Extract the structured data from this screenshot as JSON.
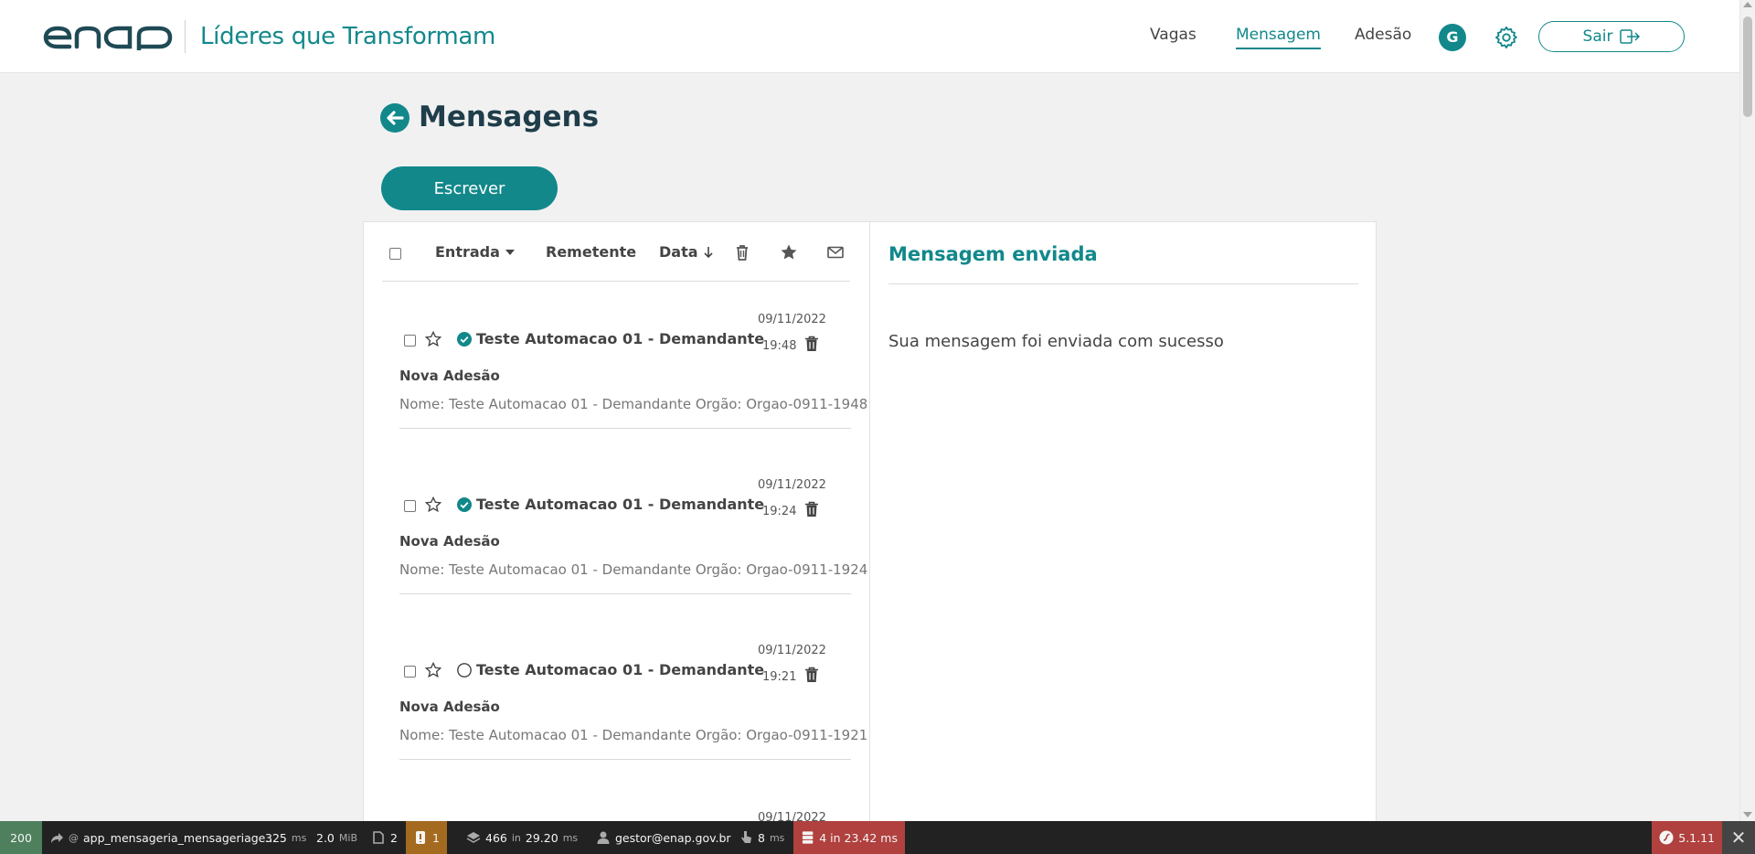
{
  "header": {
    "logo_text": "enap",
    "brand_title": "Líderes que Transformam",
    "nav": [
      {
        "label": "Vagas",
        "active": false
      },
      {
        "label": "Mensagem",
        "active": true
      },
      {
        "label": "Adesão",
        "active": false
      }
    ],
    "avatar_initial": "G",
    "logout_label": "Sair",
    "icons": {
      "settings": "gear-icon",
      "logout": "logout-icon"
    }
  },
  "page": {
    "title": "Mensagens",
    "back_icon": "arrow-left-circle-icon",
    "write_button": "Escrever"
  },
  "toolbar": {
    "folder_label": "Entrada",
    "sender_label": "Remetente",
    "date_label": "Data",
    "icons": [
      "trash-icon",
      "star-icon",
      "envelope-icon"
    ]
  },
  "messages": [
    {
      "sender": "Teste Automacao 01 - Demandante",
      "date": "09/11/2022",
      "time": "19:48",
      "read": true,
      "subject": "Nova Adesão",
      "preview": "Nome: Teste Automacao 01 - Demandante Orgão: Orgao-0911-1948"
    },
    {
      "sender": "Teste Automacao 01 - Demandante",
      "date": "09/11/2022",
      "time": "19:24",
      "read": true,
      "subject": "Nova Adesão",
      "preview": "Nome: Teste Automacao 01 - Demandante Orgão: Orgao-0911-1924"
    },
    {
      "sender": "Teste Automacao 01 - Demandante",
      "date": "09/11/2022",
      "time": "19:21",
      "read": false,
      "subject": "Nova Adesão",
      "preview": "Nome: Teste Automacao 01 - Demandante Orgão: Orgao-0911-1921"
    }
  ],
  "partial_message_date": "09/11/2022",
  "detail": {
    "title": "Mensagem enviada",
    "body": "Sua mensagem foi enviada com sucesso"
  },
  "debug_bar": {
    "status": "200",
    "route": "app_mensageria_mensageriage...",
    "time": "325",
    "time_unit": "ms",
    "memory": "2.0",
    "memory_unit": "MiB",
    "forms": "2",
    "logs": "1",
    "twig": "466",
    "twig_in": "in",
    "twig_time": "29.20",
    "twig_unit": "ms",
    "user": "gestor@enap.gov.br",
    "events_time": "8",
    "events_unit": "ms",
    "db": "4 in 23.42 ms",
    "version": "5.1.11",
    "colors": {
      "status": "#4f805d",
      "warn": "#a46a1f",
      "error": "#b0413e"
    }
  },
  "colors": {
    "accent": "#12888b",
    "title": "#1f3d4a",
    "background": "#f1f1f1"
  }
}
